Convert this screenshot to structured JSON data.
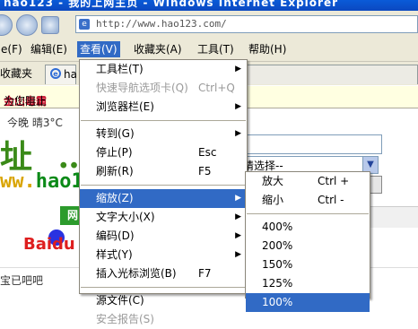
{
  "window": {
    "title": "hao123 - 我的上网主页 - Windows Internet Explorer"
  },
  "address_bar": {
    "url": "http://www.hao123.com/"
  },
  "menubar": {
    "items": [
      {
        "label": "e(F)"
      },
      {
        "label": "编辑(E)"
      },
      {
        "label": "查看(V)"
      },
      {
        "label": "收藏夹(A)"
      },
      {
        "label": "工具(T)"
      },
      {
        "label": "帮助(H)"
      }
    ]
  },
  "tabs": {
    "favorites_label": "收藏夹",
    "tab1_label": "ha"
  },
  "page": {
    "info_red": "金山毒霸",
    "info_text": "为您阻止",
    "weather": "今晚 晴3°C",
    "logo_big": "址 …",
    "logo_hao_prefix": "ww.",
    "logo_hao_name": "hao1",
    "select_text": "请选择--",
    "green_tab": "网",
    "news_tab": "新 闻",
    "baidu": "Baidu",
    "bottom_text": "宝已吧吧"
  },
  "view_menu": {
    "items": [
      {
        "label": "工具栏(T)",
        "shortcut": "",
        "submenu": true,
        "disabled": false
      },
      {
        "label": "快速导航选项卡(Q)",
        "shortcut": "Ctrl+Q",
        "submenu": false,
        "disabled": true
      },
      {
        "label": "浏览器栏(E)",
        "shortcut": "",
        "submenu": true,
        "disabled": false
      },
      {
        "separator": true
      },
      {
        "label": "转到(G)",
        "shortcut": "",
        "submenu": true,
        "disabled": false
      },
      {
        "label": "停止(P)",
        "shortcut": "Esc",
        "submenu": false,
        "disabled": false
      },
      {
        "label": "刷新(R)",
        "shortcut": "F5",
        "submenu": false,
        "disabled": false
      },
      {
        "separator": true
      },
      {
        "label": "缩放(Z)",
        "shortcut": "",
        "submenu": true,
        "disabled": false,
        "selected": true
      },
      {
        "label": "文字大小(X)",
        "shortcut": "",
        "submenu": true,
        "disabled": false
      },
      {
        "label": "编码(D)",
        "shortcut": "",
        "submenu": true,
        "disabled": false
      },
      {
        "label": "样式(Y)",
        "shortcut": "",
        "submenu": true,
        "disabled": false
      },
      {
        "label": "插入光标浏览(B)",
        "shortcut": "F7",
        "submenu": false,
        "disabled": false
      },
      {
        "separator": true
      },
      {
        "label": "源文件(C)",
        "shortcut": "",
        "submenu": false,
        "disabled": false
      },
      {
        "label": "安全报告(S)",
        "shortcut": "",
        "submenu": false,
        "disabled": true
      }
    ]
  },
  "zoom_menu": {
    "items": [
      {
        "label": "放大",
        "shortcut": "Ctrl +"
      },
      {
        "label": "缩小",
        "shortcut": "Ctrl -"
      },
      {
        "separator": true
      },
      {
        "label": "400%",
        "shortcut": ""
      },
      {
        "label": "200%",
        "shortcut": ""
      },
      {
        "label": "150%",
        "shortcut": ""
      },
      {
        "label": "125%",
        "shortcut": ""
      },
      {
        "label": "100%",
        "shortcut": "",
        "selected": true
      }
    ]
  }
}
